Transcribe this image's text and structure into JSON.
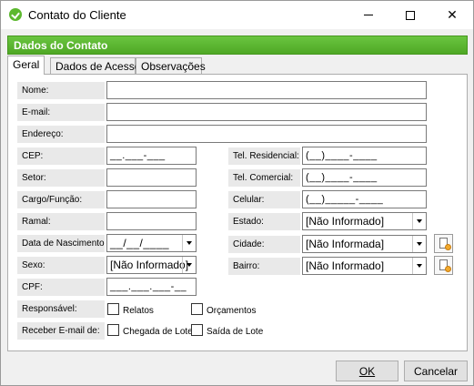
{
  "window": {
    "title": "Contato do Cliente",
    "accent": "#5cb82e"
  },
  "section_header": "Dados do Contato",
  "tabs": [
    {
      "label": "Geral",
      "active": true
    },
    {
      "label": "Dados de Acesso",
      "active": false
    },
    {
      "label": "Observações",
      "active": false
    }
  ],
  "left_fields": {
    "nome": {
      "label": "Nome:",
      "value": ""
    },
    "email": {
      "label": "E-mail:",
      "value": ""
    },
    "endereco": {
      "label": "Endereço:",
      "value": ""
    },
    "cep": {
      "label": "CEP:",
      "value": "__.___-___"
    },
    "setor": {
      "label": "Setor:",
      "value": ""
    },
    "cargo": {
      "label": "Cargo/Função:",
      "value": ""
    },
    "ramal": {
      "label": "Ramal:",
      "value": ""
    },
    "nascimento": {
      "label": "Data de Nascimento:",
      "value": "__/__/____"
    },
    "sexo": {
      "label": "Sexo:",
      "value": "[Não Informado]"
    },
    "cpf": {
      "label": "CPF:",
      "value": "___.___.___-__"
    }
  },
  "right_fields": {
    "tel_residencial": {
      "label": "Tel. Residencial:",
      "value": "(__)____-____"
    },
    "tel_comercial": {
      "label": "Tel. Comercial:",
      "value": "(__)____-____"
    },
    "celular": {
      "label": "Celular:",
      "value": "(__)_____-____"
    },
    "estado": {
      "label": "Estado:",
      "value": "[Não Informado]"
    },
    "cidade": {
      "label": "Cidade:",
      "value": "[Não Informada]"
    },
    "bairro": {
      "label": "Bairro:",
      "value": "[Não Informado]"
    }
  },
  "responsavel": {
    "label": "Responsável:",
    "options": [
      {
        "label": "Relatos",
        "checked": false
      },
      {
        "label": "Orçamentos",
        "checked": false
      }
    ]
  },
  "receber_email": {
    "label": "Receber E-mail de:",
    "options": [
      {
        "label": "Chegada de Lote",
        "checked": false
      },
      {
        "label": "Saída de Lote",
        "checked": false
      }
    ]
  },
  "buttons": {
    "ok_label": "OK",
    "cancel_label": "Cancelar"
  }
}
